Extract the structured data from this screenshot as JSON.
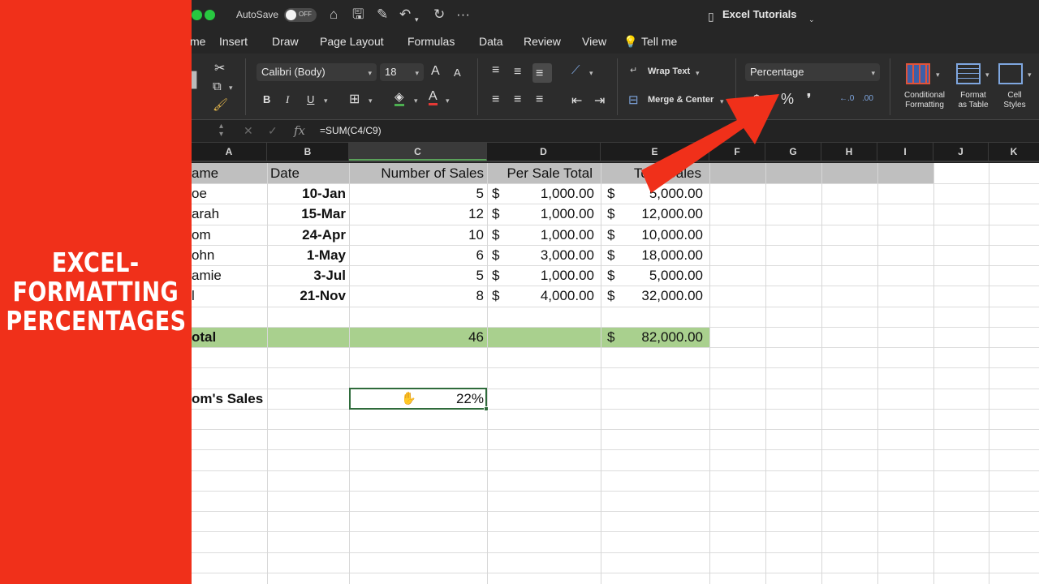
{
  "banner": {
    "lines": [
      "EXCEL-",
      "FORMATTING",
      "PERCENTAGES"
    ]
  },
  "titlebar": {
    "autosave_label": "AutoSave",
    "autosave_state": "OFF",
    "document_title": "Excel Tutorials",
    "icons": [
      "home-icon",
      "save-icon",
      "edit-icon",
      "undo-icon",
      "redo-icon",
      "more-icon"
    ]
  },
  "menu": {
    "tabs": [
      "me",
      "Insert",
      "Draw",
      "Page Layout",
      "Formulas",
      "Data",
      "Review",
      "View",
      "Tell me"
    ]
  },
  "ribbon": {
    "font_name": "Calibri (Body)",
    "font_size": "18",
    "wrap_text": "Wrap Text",
    "merge_center": "Merge & Center",
    "number_format": "Percentage",
    "conditional_formatting": [
      "Conditional",
      "Formatting"
    ],
    "format_as_table": [
      "Format",
      "as Table"
    ],
    "cell_styles": [
      "Cell",
      "Styles"
    ],
    "bold": "B",
    "italic": "I",
    "underline": "U",
    "font_grow": "A",
    "font_shrink": "A",
    "currency": "$",
    "percent": "%",
    "comma": "❜"
  },
  "formula_bar": {
    "fx": "fx",
    "formula": "=SUM(C4/C9)"
  },
  "columns": [
    "A",
    "B",
    "C",
    "D",
    "E",
    "F",
    "G",
    "H",
    "I",
    "J",
    "K"
  ],
  "sheet": {
    "header": {
      "a": "ame",
      "b": "Date",
      "c": "Number of Sales",
      "d": "Per Sale Total",
      "e": "Total Sales"
    },
    "rows": [
      {
        "a": "oe",
        "b": "10-Jan",
        "c": "5",
        "d_sym": "$",
        "d": "1,000.00",
        "e_sym": "$",
        "e": "5,000.00"
      },
      {
        "a": "arah",
        "b": "15-Mar",
        "c": "12",
        "d_sym": "$",
        "d": "1,000.00",
        "e_sym": "$",
        "e": "12,000.00"
      },
      {
        "a": "om",
        "b": "24-Apr",
        "c": "10",
        "d_sym": "$",
        "d": "1,000.00",
        "e_sym": "$",
        "e": "10,000.00"
      },
      {
        "a": "ohn",
        "b": "1-May",
        "c": "6",
        "d_sym": "$",
        "d": "3,000.00",
        "e_sym": "$",
        "e": "18,000.00"
      },
      {
        "a": "amie",
        "b": "3-Jul",
        "c": "5",
        "d_sym": "$",
        "d": "1,000.00",
        "e_sym": "$",
        "e": "5,000.00"
      },
      {
        "a": "l",
        "b": "21-Nov",
        "c": "8",
        "d_sym": "$",
        "d": "4,000.00",
        "e_sym": "$",
        "e": "32,000.00"
      }
    ],
    "total": {
      "a": "otal",
      "c": "46",
      "e_sym": "$",
      "e": "82,000.00"
    },
    "toms_sales": {
      "label": "om's Sales",
      "value": "22%"
    }
  },
  "colors": {
    "banner": "#f0301a",
    "header_row": "#bfbfbf",
    "total_row": "#a9d08e",
    "arrow": "#f0301a",
    "selection": "#2f6b3b"
  }
}
